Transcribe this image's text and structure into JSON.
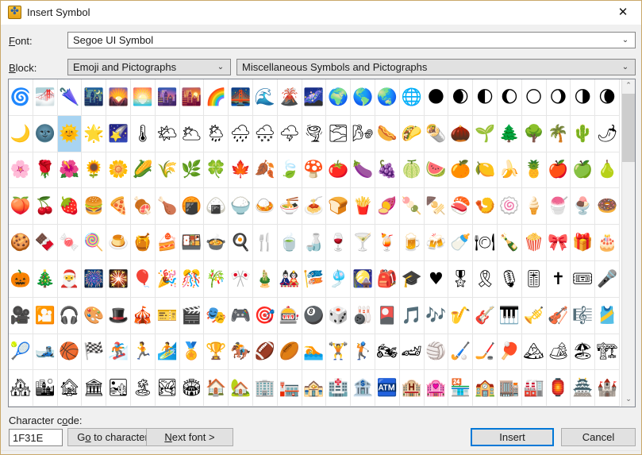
{
  "window": {
    "title": "Insert Symbol",
    "icon": "insert-symbol-icon",
    "icon_glyph": "✤",
    "close_label": "✕",
    "border_color": "#c9a86a"
  },
  "form": {
    "font": {
      "label_prefix": "F",
      "label_rest": "ont:",
      "value": "Segoe UI Symbol",
      "arrow": "⌄"
    },
    "block": {
      "label_prefix": "B",
      "label_rest": "lock:",
      "value": "Emoji and Pictographs",
      "arrow": "⌄"
    },
    "subset": {
      "value": "Miscellaneous Symbols and Pictographs",
      "arrow": "⌄"
    }
  },
  "grid": {
    "columns": 25,
    "selected_index": 27,
    "selection_color": "#a8d4f2",
    "start_codepoint": "1F300",
    "symbols": [
      "🌀",
      "🌁",
      "🌂",
      "🌃",
      "🌄",
      "🌅",
      "🌆",
      "🌇",
      "🌈",
      "🌉",
      "🌊",
      "🌋",
      "🌌",
      "🌍",
      "🌎",
      "🌏",
      "🌐",
      "🌑",
      "🌒",
      "🌓",
      "🌔",
      "🌕",
      "🌖",
      "🌗",
      "🌘",
      "🌙",
      "🌚",
      "🌞",
      "🌟",
      "🌠",
      "🌡",
      "🌤",
      "🌥",
      "🌦",
      "🌧",
      "🌨",
      "🌩",
      "🌪",
      "🌫",
      "🌬",
      "🌭",
      "🌮",
      "🌯",
      "🌰",
      "🌱",
      "🌲",
      "🌳",
      "🌴",
      "🌵",
      "🌶",
      "🌸",
      "🌹",
      "🌺",
      "🌻",
      "🌼",
      "🌽",
      "🌾",
      "🌿",
      "🍀",
      "🍁",
      "🍂",
      "🍃",
      "🍄",
      "🍅",
      "🍆",
      "🍇",
      "🍈",
      "🍉",
      "🍊",
      "🍋",
      "🍌",
      "🍍",
      "🍎",
      "🍏",
      "🍐",
      "🍑",
      "🍒",
      "🍓",
      "🍔",
      "🍕",
      "🍖",
      "🍗",
      "🍘",
      "🍙",
      "🍚",
      "🍛",
      "🍜",
      "🍝",
      "🍞",
      "🍟",
      "🍠",
      "🍡",
      "🍢",
      "🍣",
      "🍤",
      "🍥",
      "🍦",
      "🍧",
      "🍨",
      "🍩",
      "🍪",
      "🍫",
      "🍬",
      "🍭",
      "🍮",
      "🍯",
      "🍰",
      "🍱",
      "🍲",
      "🍳",
      "🍴",
      "🍵",
      "🍶",
      "🍷",
      "🍸",
      "🍹",
      "🍺",
      "🍻",
      "🍼",
      "🍽",
      "🍾",
      "🍿",
      "🎀",
      "🎁",
      "🎂",
      "🎃",
      "🎄",
      "🎅",
      "🎆",
      "🎇",
      "🎈",
      "🎉",
      "🎊",
      "🎋",
      "🎌",
      "🎍",
      "🎎",
      "🎏",
      "🎐",
      "🎑",
      "🎒",
      "🎓",
      "♥",
      "🎖",
      "🎗",
      "🎙",
      "🎚",
      "✝",
      "🎟",
      "🎤",
      "🎥",
      "🎦",
      "🎧",
      "🎨",
      "🎩",
      "🎪",
      "🎫",
      "🎬",
      "🎭",
      "🎮",
      "🎯",
      "🎰",
      "🎱",
      "🎲",
      "🎳",
      "🎴",
      "🎵",
      "🎶",
      "🎷",
      "🎸",
      "🎹",
      "🎺",
      "🎻",
      "🎼",
      "🎽",
      "🎾",
      "🎿",
      "🏀",
      "🏁",
      "🏂",
      "🏃",
      "🏄",
      "🏅",
      "🏆",
      "🏇",
      "🏈",
      "🏉",
      "🏊",
      "🏋",
      "🏌",
      "🏍",
      "🏎",
      "🏐",
      "🏑",
      "🏒",
      "🏓",
      "🏔",
      "🏕",
      "🏖",
      "🏗",
      "🏘",
      "🏙",
      "🏚",
      "🏛",
      "🏜",
      "🏝",
      "🏞",
      "🏟",
      "🏠",
      "🏡",
      "🏢",
      "🏣",
      "🏤",
      "🏥",
      "🏦",
      "🏧",
      "🏨",
      "🏩",
      "🏪",
      "🏫",
      "🏬",
      "🏭",
      "🏮",
      "🏯",
      "🏰"
    ]
  },
  "scrollbar": {
    "up_arrow": "⌃",
    "down_arrow": "⌄"
  },
  "bottom": {
    "charcode_label": "Character c",
    "charcode_label_underlined": "o",
    "charcode_label_rest": "de:",
    "charcode_value": "1F31E",
    "goto_prefix": "G",
    "goto_underlined": "o",
    "goto_rest": " to character",
    "nextfont_underlined": "N",
    "nextfont_rest": "ext font >",
    "insert_label": "Insert",
    "cancel_label": "Cancel"
  }
}
